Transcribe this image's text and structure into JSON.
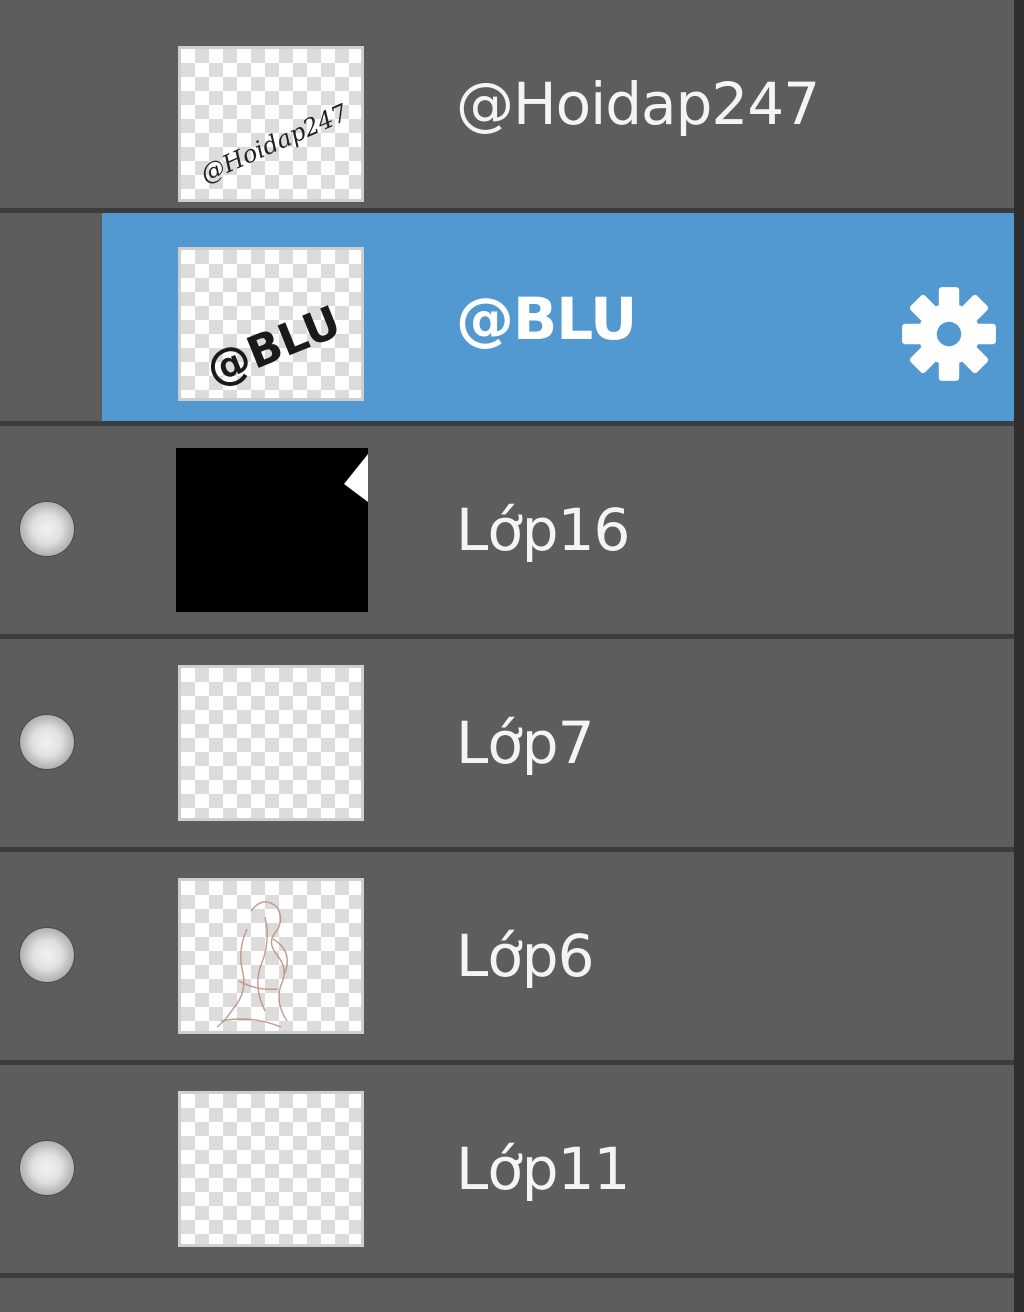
{
  "layers_panel": {
    "layers": [
      {
        "name": "@Hoidap247",
        "thumb_text": "@Hoidap247",
        "visibility_toggle": false,
        "selected": false
      },
      {
        "name": "@BLU",
        "thumb_text": "@BLU",
        "visibility_toggle": false,
        "selected": true,
        "settings_icon": "gear-icon"
      },
      {
        "name": "Lớp16",
        "visibility_toggle": true,
        "selected": false
      },
      {
        "name": "Lớp7",
        "visibility_toggle": true,
        "selected": false
      },
      {
        "name": "Lớp6",
        "visibility_toggle": true,
        "selected": false
      },
      {
        "name": "Lớp11",
        "visibility_toggle": true,
        "selected": false
      }
    ]
  },
  "colors": {
    "row_background": "#5d5d5d",
    "selected_background": "#5399d1",
    "divider": "#3c3c3c",
    "label_text": "#f4f4f4"
  }
}
